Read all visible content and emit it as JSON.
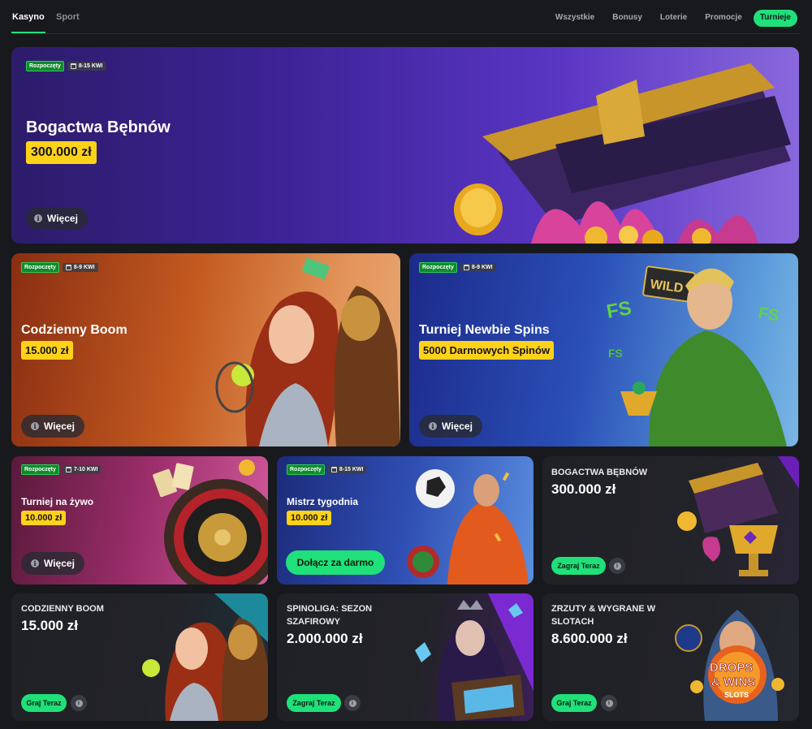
{
  "nav": {
    "tabs": [
      {
        "label": "Kasyno",
        "active": true
      },
      {
        "label": "Sport",
        "active": false
      }
    ],
    "filters": [
      {
        "label": "Wszystkie",
        "active": false
      },
      {
        "label": "Bonusy",
        "active": false
      },
      {
        "label": "Loterie",
        "active": false
      },
      {
        "label": "Promocje",
        "active": false
      },
      {
        "label": "Turnieje",
        "active": true
      }
    ]
  },
  "hero": {
    "status": "Rozpoczęty",
    "dates": "8-15 KWI",
    "title": "Bogactwa Bębnów",
    "prize": "300.000 zł",
    "more_label": "Więcej"
  },
  "row2": [
    {
      "status": "Rozpoczęty",
      "dates": "8-9 KWI",
      "title": "Codzienny Boom",
      "prize": "15.000 zł",
      "more_label": "Więcej"
    },
    {
      "status": "Rozpoczęty",
      "dates": "8-9 KWI",
      "title": "Turniej Newbie Spins",
      "prize": "5000 Darmowych Spinów",
      "more_label": "Więcej"
    }
  ],
  "row3": [
    {
      "status": "Rozpoczęty",
      "dates": "7-10 KWI",
      "title": "Turniej na żywo",
      "prize": "10.000 zł",
      "more_label": "Więcej"
    },
    {
      "status": "Rozpoczęty",
      "dates": "8-15 KWI",
      "title": "Mistrz tygodnia",
      "prize": "10.000 zł",
      "join_label": "Dołącz za darmo"
    },
    {
      "title": "BOGACTWA BĘBNÓW",
      "prize": "300.000 zł",
      "play_label": "Zagraj Teraz"
    }
  ],
  "row4": [
    {
      "title": "CODZIENNY BOOM",
      "prize": "15.000 zł",
      "play_label": "Graj Teraz"
    },
    {
      "title": "SPINOLIGA: SEZON SZAFIROWY",
      "prize": "2.000.000 zł",
      "play_label": "Zagraj Teraz"
    },
    {
      "title": "ZRZUTY & WYGRANE W SLOTACH",
      "prize": "8.600.000 zł",
      "play_label": "Graj Teraz"
    }
  ],
  "art_text": {
    "wild": "WILD",
    "fs": "FS",
    "drops": "DROPS",
    "wins": "& WINS",
    "slots": "SLOTS"
  },
  "icons": {
    "info": "i",
    "calendar": "calendar-icon"
  },
  "colors": {
    "accent": "#20e07a",
    "prize_badge": "#ffd21a",
    "status_green": "#0f8a2c",
    "background": "#18191d",
    "card_dark": "#222328"
  }
}
